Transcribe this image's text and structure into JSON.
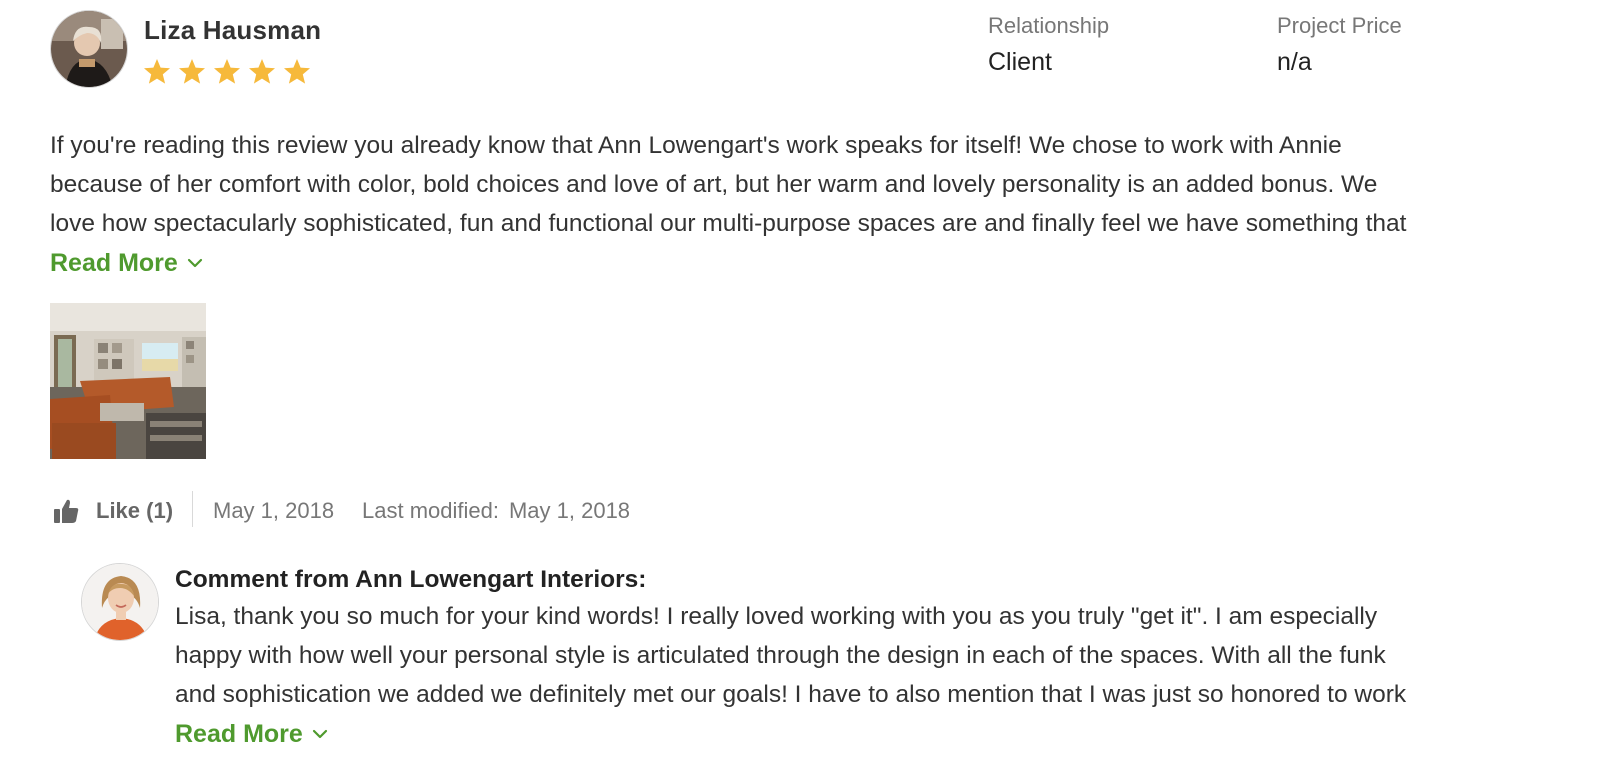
{
  "review": {
    "reviewer_name": "Liza Hausman",
    "rating": 5,
    "rating_max": 5,
    "relationship_label": "Relationship",
    "relationship_value": "Client",
    "price_label": "Project Price",
    "price_value": "n/a",
    "body_lines": [
      "If you're reading this review you already know that Ann Lowengart's work speaks for itself! We chose to work with Annie",
      "because of her comfort with color, bold choices and love of art, but her warm and lovely personality is an added bonus. We",
      "love how spectacularly sophisticated, fun and functional our multi-purpose spaces are and finally feel we have something that"
    ],
    "read_more_label": "Read More",
    "like_label": "Like (1)",
    "date": "May 1, 2018",
    "last_modified_label": "Last modified:",
    "last_modified_date": "May 1, 2018"
  },
  "comment": {
    "title": "Comment from Ann Lowengart Interiors:",
    "body_lines": [
      "Lisa, thank you so much for your kind words! I really loved working with you as you truly \"get it\". I am especially",
      "happy with how well your personal style is articulated through the design in each of the spaces. With all the funk",
      "and sophistication we added we definitely met our goals! I have to also mention that I was just so honored to work"
    ],
    "read_more_label": "Read More"
  },
  "colors": {
    "star": "#f6b93b",
    "link_green": "#4f9a2e",
    "muted_text": "#777777"
  },
  "icons": {
    "like": "thumbs-up-icon",
    "read_more": "chevron-down-icon",
    "rating": "star-icon"
  }
}
